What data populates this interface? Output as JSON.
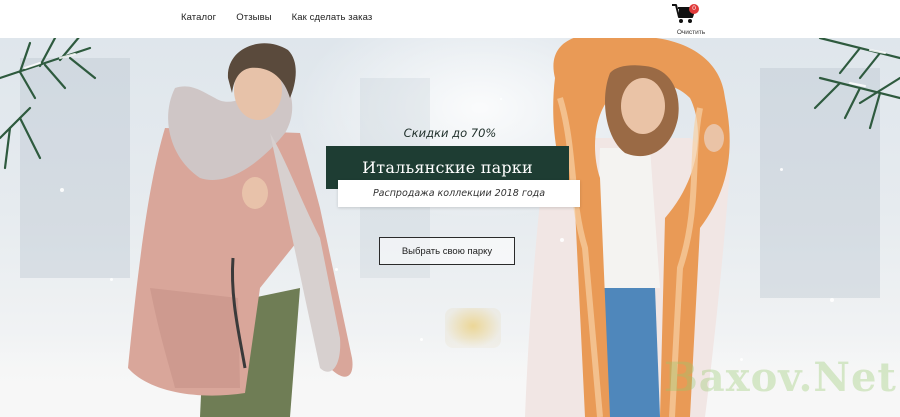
{
  "nav": {
    "items": [
      "Каталог",
      "Отзывы",
      "Как сделать заказ"
    ]
  },
  "cart": {
    "count": "0",
    "clear_label": "Очистить",
    "icon": "shopping-cart-icon"
  },
  "hero": {
    "discount": "Скидки до 70%",
    "title": "Итальянские парки",
    "subtitle": "Распродажа коллекции 2018 года",
    "cta": "Выбрать свою парку"
  },
  "watermark": "Baxov.Net",
  "colors": {
    "title_bg": "#1e3d33",
    "badge": "#e03a3a",
    "pine": "#2e5a3e"
  }
}
